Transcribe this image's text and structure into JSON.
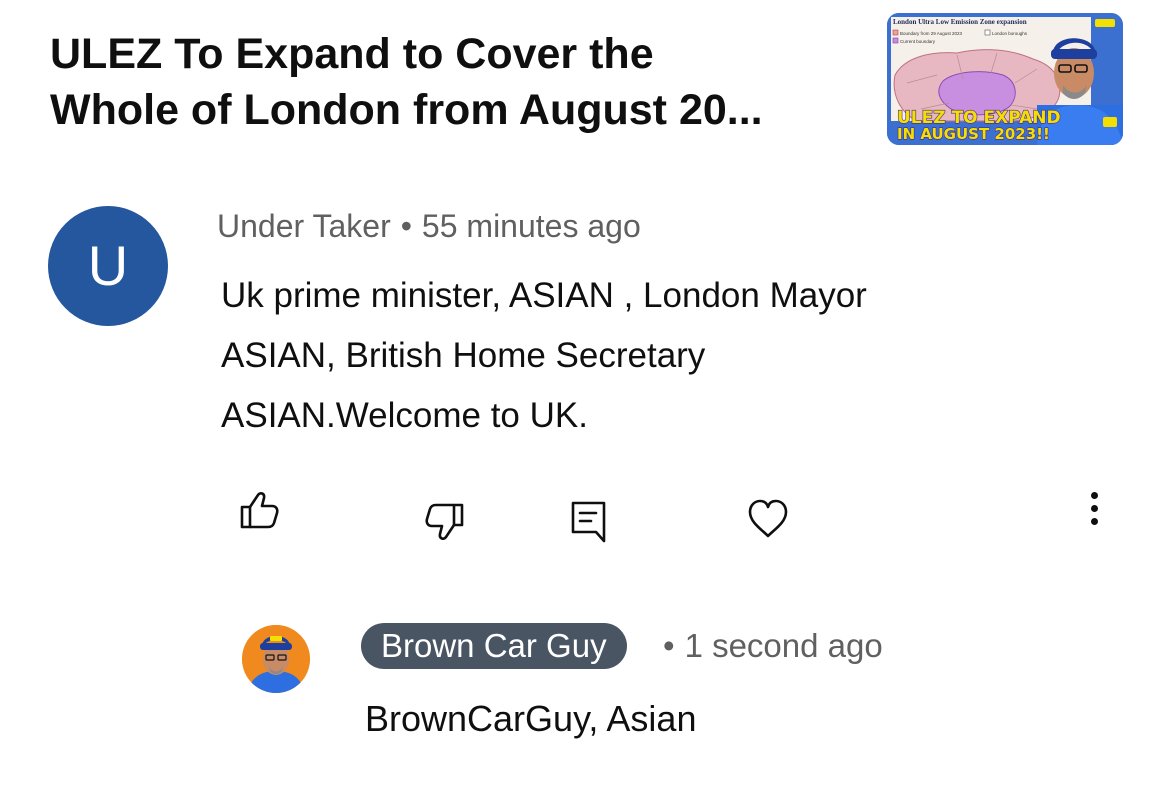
{
  "video": {
    "title_line1": "ULEZ To Expand to Cover the",
    "title_line2": "Whole of London from August 20...",
    "thumbnail": {
      "heading": "London Ultra Low Emission Zone expansion",
      "legend_1": "Boundary from 29 August 2023",
      "legend_2": "London boroughs",
      "legend_3": "Current boundary",
      "caption_line1": "ULEZ TO EXPAND",
      "caption_line2": "IN AUGUST 2023!!"
    }
  },
  "comment": {
    "avatar_letter": "U",
    "author": "Under Taker",
    "separator": "•",
    "time": "55 minutes ago",
    "text_lines": [
      "Uk prime minister, ASIAN , London Mayor",
      "ASIAN, British Home Secretary",
      "ASIAN.Welcome to UK."
    ],
    "actions": [
      "like-icon",
      "dislike-icon",
      "reply-icon",
      "heart-icon",
      "more-vertical-icon"
    ]
  },
  "reply": {
    "author": "Brown Car Guy",
    "separator": "•",
    "time": "1 second ago",
    "text": "BrownCarGuy, Asian"
  },
  "colors": {
    "avatar_bg": "#24579d",
    "author_badge_bg": "#4a5563",
    "meta_text": "#606060",
    "thumbnail_bg": "#3b6fd0",
    "thumbnail_caption": "#f3e000"
  }
}
